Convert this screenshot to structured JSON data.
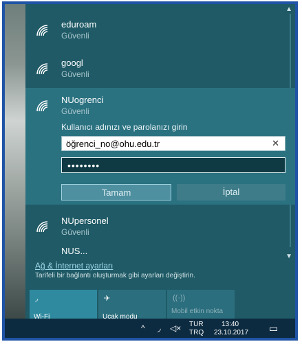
{
  "networks": [
    {
      "name": "eduroam",
      "status": "Güvenli"
    },
    {
      "name": "googl",
      "status": "Güvenli"
    },
    {
      "name": "NUogrenci",
      "status": "Güvenli"
    },
    {
      "name": "NUpersonel",
      "status": "Güvenli"
    },
    {
      "name": "NUS...",
      "status": ""
    }
  ],
  "auth": {
    "prompt": "Kullanıcı adınızı ve parolanızı girin",
    "username": "öğrenci_no@ohu.edu.tr",
    "password_mask": "••••••••",
    "ok_label": "Tamam",
    "cancel_label": "İptal"
  },
  "settings": {
    "link": "Ağ & İnternet ayarları",
    "desc": "Tarifeli bir bağlantı oluşturmak gibi ayarları değiştirin."
  },
  "quick_actions": [
    {
      "label": "Wi-Fi",
      "icon": "wifi-icon"
    },
    {
      "label": "Uçak modu",
      "icon": "airplane-icon"
    },
    {
      "label": "Mobil etkin nokta",
      "icon": "hotspot-icon"
    }
  ],
  "taskbar": {
    "lang_top": "TUR",
    "lang_bottom": "TRQ",
    "time": "13:40",
    "date": "23.10.2017"
  },
  "colors": {
    "panel": "#1f5a66",
    "selected": "#2b7281",
    "accent": "#2f8aa0",
    "border": "#1f53a5"
  }
}
